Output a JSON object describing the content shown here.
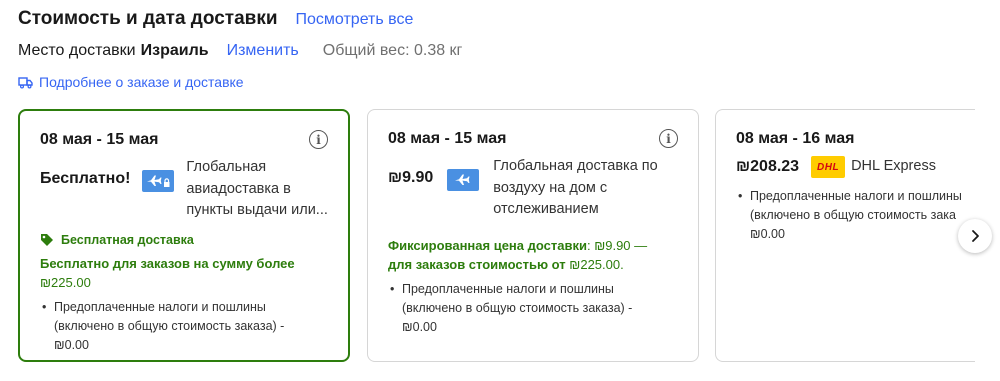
{
  "header": {
    "title": "Стоимость и дата доставки",
    "view_all": "Посмотреть все"
  },
  "location": {
    "label": "Место доставки",
    "country": "Израиль",
    "change": "Изменить",
    "weight": "Общий вес: 0.38 кг"
  },
  "details_link": "Подробнее о заказе и доставке",
  "options": [
    {
      "dates": "08 мая - 15 мая",
      "price": "Бесплатно!",
      "service": "Глобальная авиадоставка в пункты выдачи или...",
      "badge": "Бесплатная доставка",
      "promo_text": "Бесплатно для заказов на сумму более",
      "promo_amount": "₪225.00",
      "fee_text": "Предоплаченные налоги и пошлины (включено в общую стоимость заказа) -",
      "fee_amount": "₪0.00"
    },
    {
      "dates": "08 мая - 15 мая",
      "price": "₪9.90",
      "service": "Глобальная доставка по воздуху на дом с отслеживанием",
      "promo_label": "Фиксированная цена доставки",
      "promo_price": ": ₪9.90 —",
      "promo_line2": "для заказов стоимостью от",
      "promo_min": "₪225.00.",
      "fee_text": "Предоплаченные налоги и пошлины (включено в общую стоимость заказа) -",
      "fee_amount": "₪0.00"
    },
    {
      "dates": "08 мая - 16 мая",
      "price": "₪208.23",
      "carrier_logo": "DHL",
      "service": "DHL Express",
      "fee_text": "Предоплаченные налоги и пошлины (включено в общую стоимость зака",
      "fee_amount": "₪0.00"
    }
  ],
  "colors": {
    "link": "#3665f3",
    "selected_border": "#2d7d0d",
    "promo_green": "#2d7d0d",
    "plane_icon_bg": "#4a90e2",
    "dhl_yellow": "#ffcc00",
    "dhl_red": "#d40511"
  }
}
